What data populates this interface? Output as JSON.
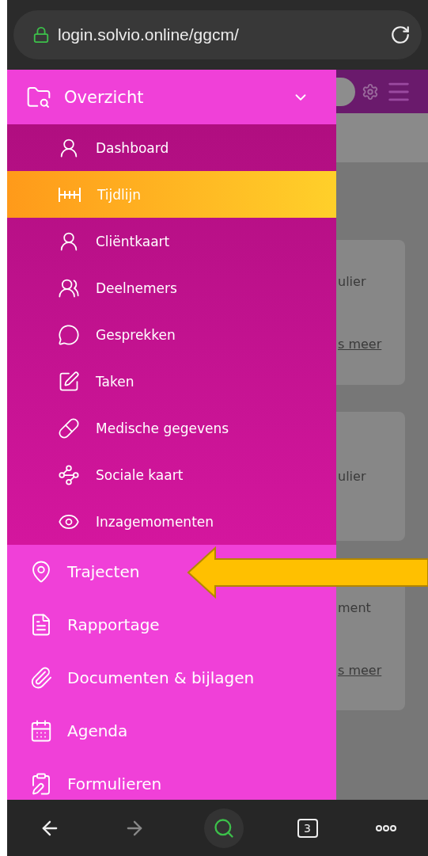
{
  "browser": {
    "url": "login.solvio.online/ggcm/",
    "tab_count": "3"
  },
  "menu": {
    "section": {
      "label": "Overzicht",
      "expanded": true
    },
    "sub_items": [
      {
        "label": "Dashboard",
        "selected": false
      },
      {
        "label": "Tijdlijn",
        "selected": true
      },
      {
        "label": "Cliëntkaart",
        "selected": false
      },
      {
        "label": "Deelnemers",
        "selected": false
      },
      {
        "label": "Gesprekken",
        "selected": false
      },
      {
        "label": "Taken",
        "selected": false
      },
      {
        "label": "Medische gegevens",
        "selected": false
      },
      {
        "label": "Sociale kaart",
        "selected": false
      },
      {
        "label": "Inzagemomenten",
        "selected": false
      }
    ],
    "items": [
      {
        "label": "Trajecten",
        "selected": false
      },
      {
        "label": "Rapportage",
        "selected": false
      },
      {
        "label": "Documenten & bijlagen",
        "selected": false
      },
      {
        "label": "Agenda",
        "selected": false
      },
      {
        "label": "Formulieren",
        "selected": false
      }
    ]
  },
  "background_cards": [
    {
      "text": "ulier",
      "link": "s meer"
    },
    {
      "text": "ulier"
    },
    {
      "text": "ment",
      "link": "s meer"
    }
  ]
}
